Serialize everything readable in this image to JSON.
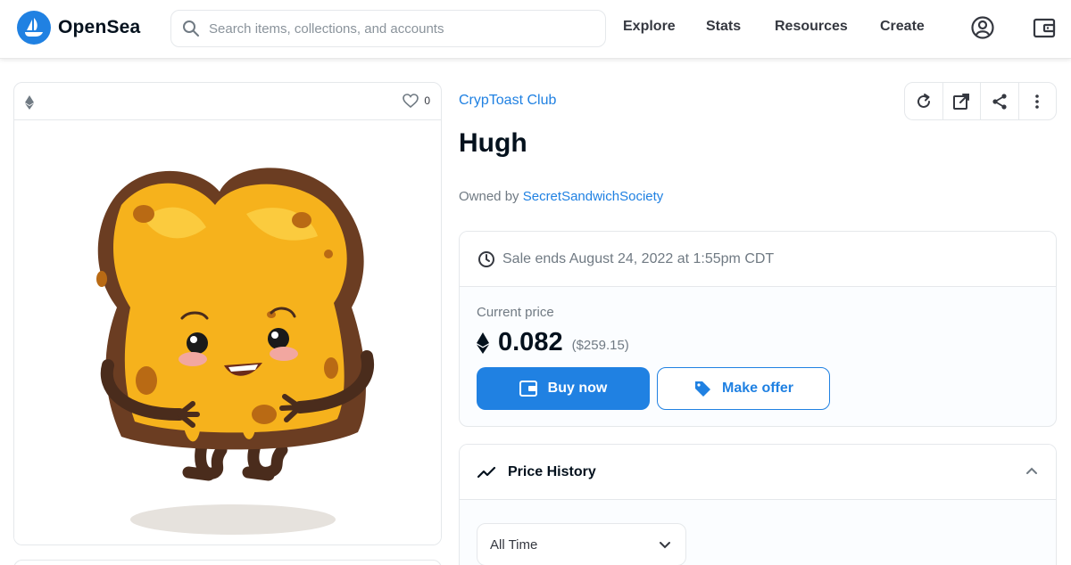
{
  "header": {
    "brand": "OpenSea",
    "search_placeholder": "Search items, collections, and accounts",
    "nav": [
      "Explore",
      "Stats",
      "Resources",
      "Create"
    ],
    "accent": "#2081e2"
  },
  "item": {
    "favorites": "0",
    "collection": "CrypToast Club",
    "title": "Hugh",
    "owned_prefix": "Owned by",
    "owner": "SecretSandwichSociety"
  },
  "sale": {
    "ends": "Sale ends August 24, 2022 at 1:55pm CDT",
    "current_price_label": "Current price",
    "price": "0.082",
    "usd": "($259.15)",
    "buy_label": "Buy now",
    "offer_label": "Make offer"
  },
  "price_history": {
    "title": "Price History",
    "range": "All Time"
  },
  "icons": {
    "header_right": [
      "account-icon",
      "wallet-icon"
    ],
    "actions": [
      "refresh-icon",
      "external-link-icon",
      "share-icon",
      "more-icon"
    ]
  }
}
